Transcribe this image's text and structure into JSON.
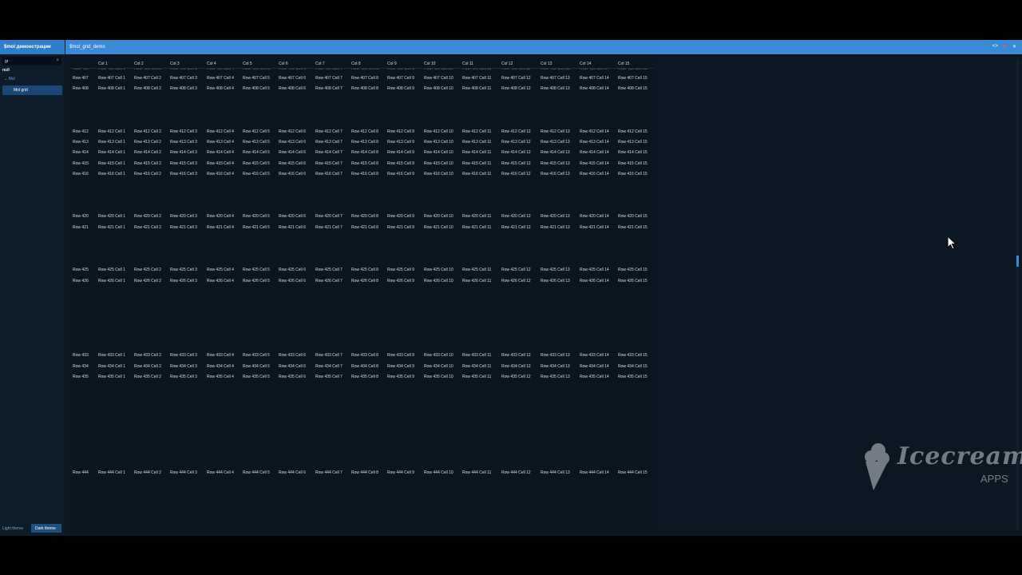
{
  "sidebar": {
    "title": "$mol демонстрации",
    "search_value": "gr",
    "nav": {
      "root": "null",
      "group": "Mol",
      "selected_item": "Mol grid"
    },
    "themes": {
      "light": "Light theme",
      "dark": "Dark theme"
    }
  },
  "page": {
    "title": "$mol_grid_demo",
    "header_icons": [
      "source-icon",
      "flag-icon",
      "close-icon"
    ]
  },
  "grid": {
    "columns": [
      "Col 1",
      "Col 2",
      "Col 3",
      "Col 4",
      "Col 5",
      "Col 6",
      "Col 7",
      "Col 8",
      "Col 9",
      "Col 10",
      "Col 11",
      "Col 12",
      "Col 13",
      "Col 14",
      "Col 15"
    ],
    "cell_pattern": "Row {r} Cell {c}",
    "partially_hidden_row": 406,
    "visible_rows": [
      407,
      408,
      412,
      413,
      414,
      415,
      416,
      420,
      421,
      425,
      426,
      433,
      434,
      435,
      444
    ]
  },
  "watermark": {
    "text": "Icecream",
    "sub": "APPS"
  },
  "colors": {
    "accent": "#3b8ad6",
    "background": "#0a1722",
    "selected": "#1a4876"
  }
}
